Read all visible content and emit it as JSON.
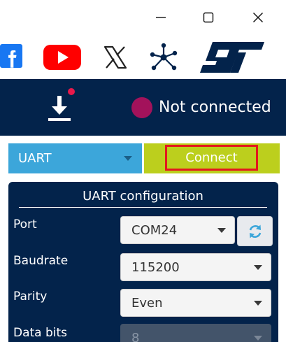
{
  "window": {
    "controls": [
      "minimize-icon",
      "maximize-icon",
      "close-icon"
    ]
  },
  "social": {
    "icons": [
      "facebook-icon",
      "youtube-icon",
      "x-icon",
      "community-icon",
      "st-logo"
    ]
  },
  "header": {
    "download_icon": "download-icon",
    "status_text": "Not connected",
    "status_color": "#a3125b"
  },
  "connection": {
    "mode_value": "UART",
    "connect_label": "Connect"
  },
  "uart_config": {
    "title": "UART configuration",
    "port_label": "Port",
    "port_value": "COM24",
    "baudrate_label": "Baudrate",
    "baudrate_value": "115200",
    "parity_label": "Parity",
    "parity_value": "Even",
    "databits_label": "Data bits",
    "databits_value": "8"
  },
  "colors": {
    "header_bg": "#03234b",
    "mode_bg": "#3ca6da",
    "connect_bg": "#bccf1d",
    "highlight": "#e3171e"
  }
}
